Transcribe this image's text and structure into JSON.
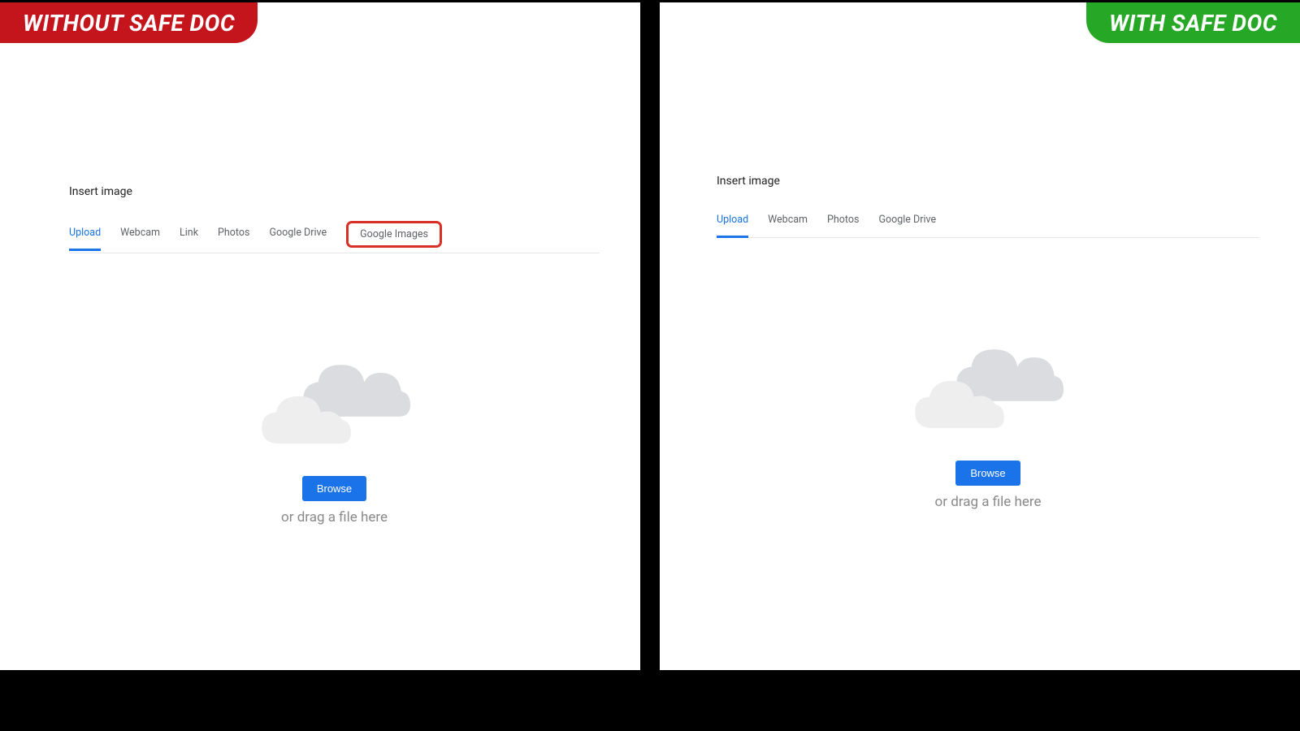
{
  "left": {
    "badge": "WITHOUT SAFE DOC",
    "dialog_title": "Insert image",
    "tabs": [
      "Upload",
      "Webcam",
      "Link",
      "Photos",
      "Google Drive",
      "Google Images"
    ],
    "active_tab_index": 0,
    "highlighted_tab_index": 5,
    "browse_label": "Browse",
    "drag_text": "or drag a file here"
  },
  "right": {
    "badge": "WITH SAFE DOC",
    "dialog_title": "Insert image",
    "tabs": [
      "Upload",
      "Webcam",
      "Photos",
      "Google Drive"
    ],
    "active_tab_index": 0,
    "browse_label": "Browse",
    "drag_text": "or drag a file here"
  },
  "colors": {
    "badge_red": "#c4151c",
    "badge_green": "#26a826",
    "highlight_red": "#d93025",
    "accent_blue": "#1a73e8"
  }
}
